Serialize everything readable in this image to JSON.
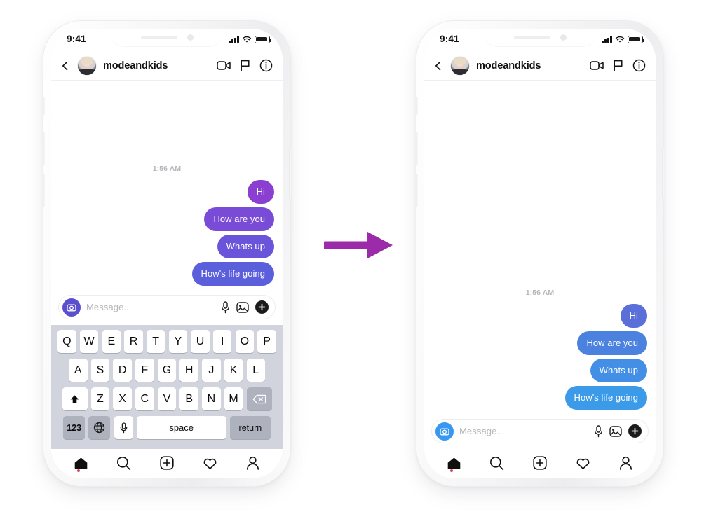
{
  "scene": {
    "title": "Instagram direct message before and after illustration",
    "arrow": {
      "icon": "right-arrow-icon",
      "color": "#9B2BA8"
    }
  },
  "phones": [
    {
      "id": "before",
      "status_bar": {
        "time": "9:41",
        "signal_icon": "cellular-signal-icon",
        "wifi_icon": "wifi-icon",
        "battery_icon": "battery-full-icon"
      },
      "header": {
        "back_icon": "chevron-left-icon",
        "avatar": "profile-avatar",
        "username": "modeandkids",
        "video_call_icon": "video-camera-icon",
        "flag_icon": "flag-icon",
        "info_icon": "info-circle-icon"
      },
      "conversation": {
        "timestamp": "1:56 AM",
        "messages": [
          {
            "text": "Hi",
            "tone": "b0"
          },
          {
            "text": "How are you",
            "tone": "b1"
          },
          {
            "text": "Whats up",
            "tone": "b2"
          },
          {
            "text": "How's life going",
            "tone": "b3"
          }
        ]
      },
      "composer": {
        "camera_icon": "camera-icon",
        "camera_color": "#5B4FCF",
        "placeholder": "Message...",
        "mic_icon": "microphone-icon",
        "gallery_icon": "photo-gallery-icon",
        "plus_icon": "plus-circle-icon"
      },
      "tabbar": {
        "items": [
          {
            "icon": "home-icon",
            "badge": true
          },
          {
            "icon": "search-icon",
            "badge": false
          },
          {
            "icon": "add-post-icon",
            "badge": false
          },
          {
            "icon": "heart-icon",
            "badge": false
          },
          {
            "icon": "profile-icon",
            "badge": false
          }
        ]
      },
      "keyboard": {
        "visible": true,
        "row1": [
          "Q",
          "W",
          "E",
          "R",
          "T",
          "Y",
          "U",
          "I",
          "O",
          "P"
        ],
        "row2": [
          "A",
          "S",
          "D",
          "F",
          "G",
          "H",
          "J",
          "K",
          "L"
        ],
        "row3": [
          "Z",
          "X",
          "C",
          "V",
          "B",
          "N",
          "M"
        ],
        "shift_icon": "shift-arrow-icon",
        "delete_icon": "backspace-icon",
        "numbers_key": "123",
        "globe_icon": "globe-icon",
        "mic_icon": "microphone-icon",
        "space_key": "space",
        "return_key": "return"
      }
    },
    {
      "id": "after",
      "status_bar": {
        "time": "9:41",
        "signal_icon": "cellular-signal-icon",
        "wifi_icon": "wifi-icon",
        "battery_icon": "battery-full-icon"
      },
      "header": {
        "back_icon": "chevron-left-icon",
        "avatar": "profile-avatar",
        "username": "modeandkids",
        "video_call_icon": "video-camera-icon",
        "flag_icon": "flag-icon",
        "info_icon": "info-circle-icon"
      },
      "conversation": {
        "timestamp": "1:56 AM",
        "messages": [
          {
            "text": "Hi",
            "tone": "b0"
          },
          {
            "text": "How are you",
            "tone": "b1"
          },
          {
            "text": "Whats up",
            "tone": "b2"
          },
          {
            "text": "How's life going",
            "tone": "b3"
          }
        ]
      },
      "composer": {
        "camera_icon": "camera-icon",
        "camera_color": "#3897F0",
        "placeholder": "Message...",
        "mic_icon": "microphone-icon",
        "gallery_icon": "photo-gallery-icon",
        "plus_icon": "plus-circle-icon"
      },
      "tabbar": {
        "items": [
          {
            "icon": "home-icon",
            "badge": true
          },
          {
            "icon": "search-icon",
            "badge": false
          },
          {
            "icon": "add-post-icon",
            "badge": false
          },
          {
            "icon": "heart-icon",
            "badge": false
          },
          {
            "icon": "profile-icon",
            "badge": false
          }
        ]
      },
      "keyboard": {
        "visible": false
      }
    }
  ]
}
